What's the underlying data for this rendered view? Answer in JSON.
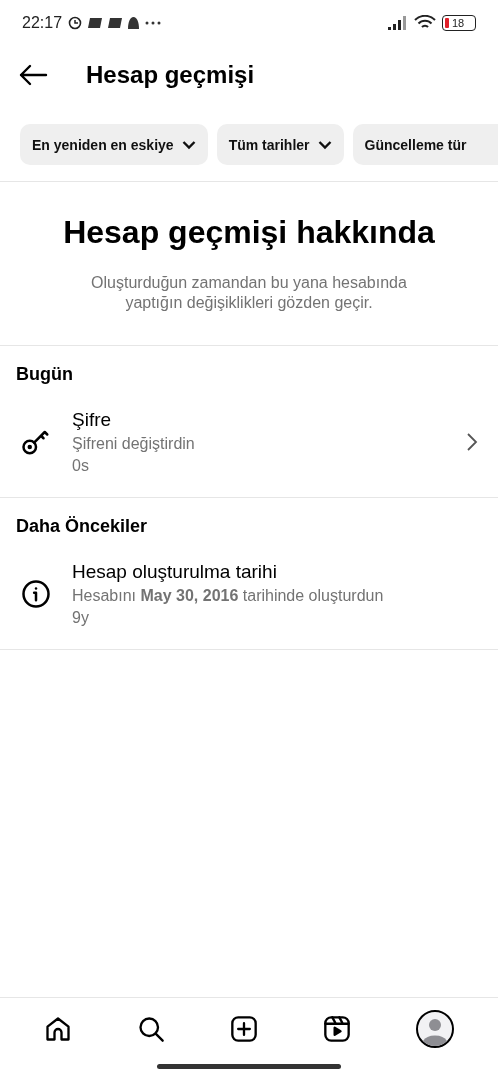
{
  "status_bar": {
    "time": "22:17",
    "battery": "18"
  },
  "header": {
    "title": "Hesap geçmişi"
  },
  "filters": [
    {
      "label": "En yeniden en eskiye",
      "dropdown": true
    },
    {
      "label": "Tüm tarihler",
      "dropdown": true
    },
    {
      "label": "Güncelleme tür",
      "dropdown": false
    }
  ],
  "about": {
    "title": "Hesap geçmişi hakkında",
    "description": "Oluşturduğun zamandan bu yana hesabında yaptığın değişiklikleri gözden geçir."
  },
  "sections": [
    {
      "title": "Bugün",
      "items": [
        {
          "kind": "key",
          "title": "Şifre",
          "description": "Şifreni değiştirdin",
          "time": "0s",
          "chevron": true
        }
      ]
    },
    {
      "title": "Daha Öncekiler",
      "items": [
        {
          "kind": "info",
          "title": "Hesap oluşturulma tarihi",
          "description": "Hesabını **May 30, 2016** tarihinde oluşturdun",
          "time": "9y",
          "chevron": false
        }
      ]
    }
  ],
  "nav": [
    {
      "kind": "home"
    },
    {
      "kind": "search"
    },
    {
      "kind": "create"
    },
    {
      "kind": "reels"
    },
    {
      "kind": "profile"
    }
  ]
}
